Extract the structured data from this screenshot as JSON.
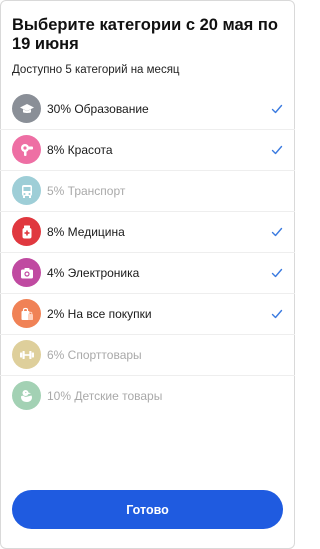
{
  "header": {
    "title": "Выберите категории с 20 мая по 19 июня",
    "subtitle": "Доступно 5 категорий на месяц"
  },
  "categories": [
    {
      "label": "30% Образование",
      "icon": "graduation-cap-icon",
      "color": "#8a8f97",
      "selected": true,
      "enabled": true
    },
    {
      "label": "8% Красота",
      "icon": "hair-dryer-icon",
      "color": "#ee6fa4",
      "selected": true,
      "enabled": true
    },
    {
      "label": "5% Транспорт",
      "icon": "bus-icon",
      "color": "#4fa7b8",
      "selected": false,
      "enabled": false
    },
    {
      "label": "8% Медицина",
      "icon": "medicine-icon",
      "color": "#e0383f",
      "selected": true,
      "enabled": true
    },
    {
      "label": "4% Электроника",
      "icon": "camera-icon",
      "color": "#c04aa1",
      "selected": true,
      "enabled": true
    },
    {
      "label": "2% На все покупки",
      "icon": "shopping-bag-icon",
      "color": "#f08256",
      "selected": true,
      "enabled": true
    },
    {
      "label": "6% Спорттовары",
      "icon": "dumbbell-icon",
      "color": "#c4a84a",
      "selected": false,
      "enabled": false
    },
    {
      "label": "10% Детские товары",
      "icon": "duck-icon",
      "color": "#58ad78",
      "selected": false,
      "enabled": false
    }
  ],
  "colors": {
    "accent": "#1f5be0",
    "check": "#3b7be0"
  },
  "footer": {
    "done_label": "Готово"
  }
}
